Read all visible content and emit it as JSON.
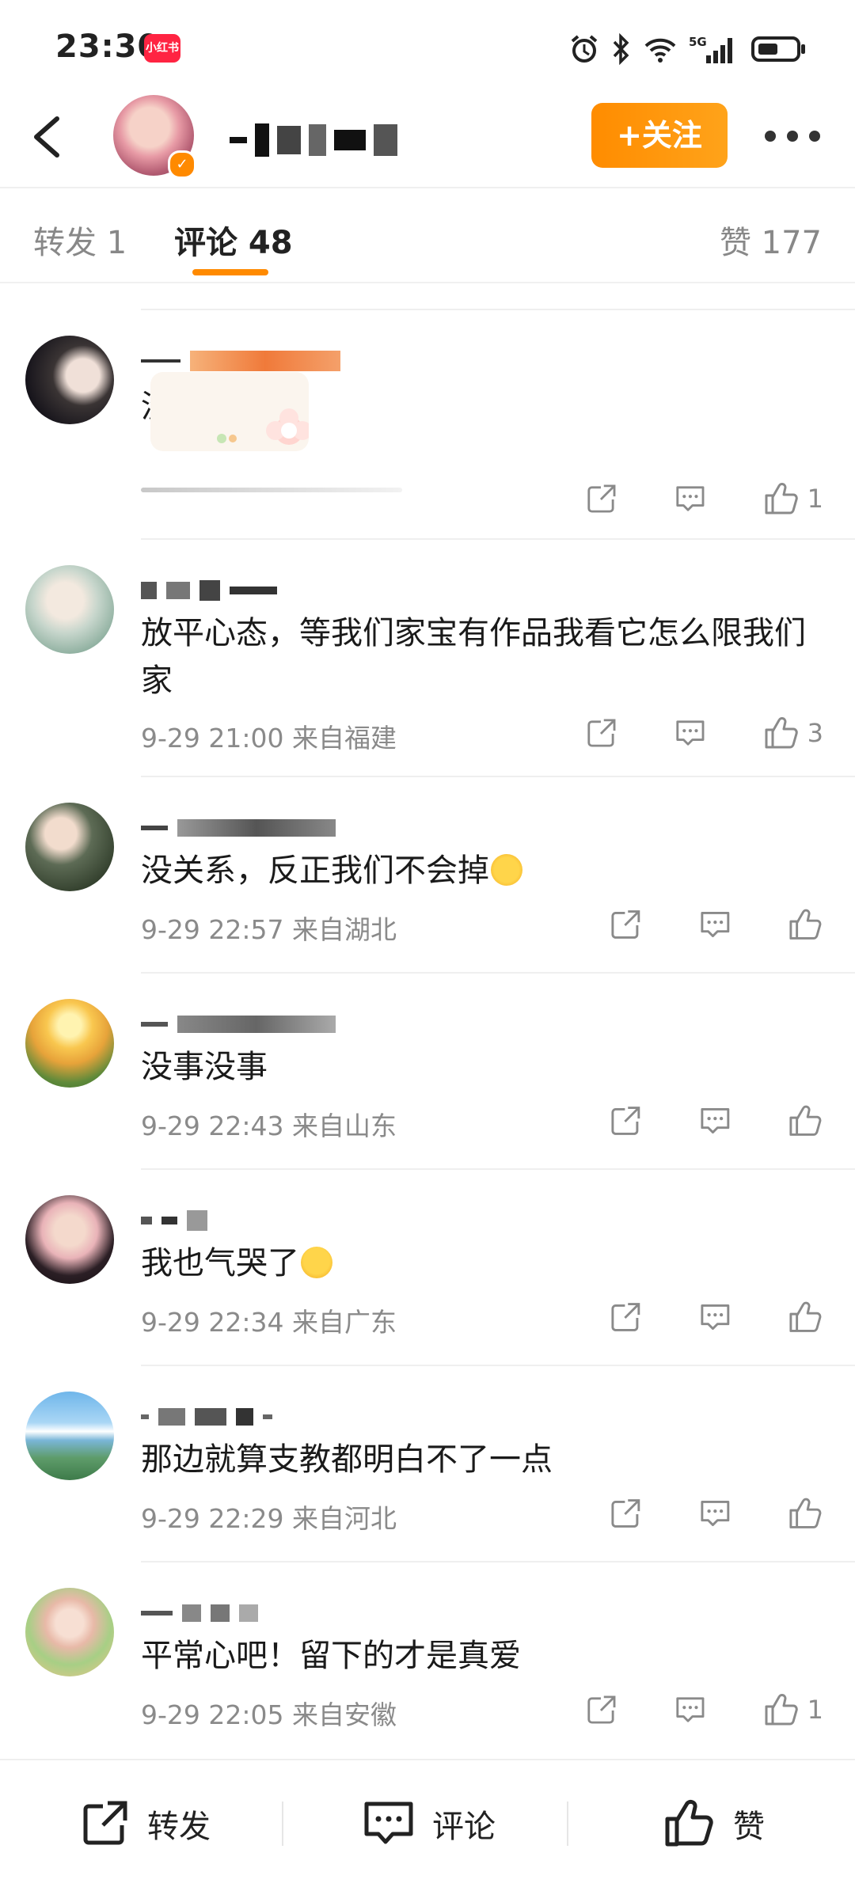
{
  "status": {
    "time": "23:30",
    "app_badge": "小红书",
    "network": "5G"
  },
  "header": {
    "follow_label": "+关注"
  },
  "tabs": {
    "repost": "转发 1",
    "comments": "评论 48",
    "likes": "赞 177"
  },
  "comments": [
    {
      "text": "没招了",
      "meta": "",
      "likes": "1"
    },
    {
      "text": "放平心态，等我们家宝有作品我看它怎么限我们家",
      "meta": "9-29 21:00 来自福建",
      "likes": "3"
    },
    {
      "text": "没关系，反正我们不会掉",
      "meta": "9-29 22:57 来自湖北",
      "likes": ""
    },
    {
      "text": "没事没事",
      "meta": "9-29 22:43 来自山东",
      "likes": ""
    },
    {
      "text": "我也气哭了",
      "meta": "9-29 22:34 来自广东",
      "likes": ""
    },
    {
      "text": "那边就算支教都明白不了一点",
      "meta": "9-29 22:29 来自河北",
      "likes": ""
    },
    {
      "text": "平常心吧！留下的才是真爱",
      "meta": "9-29 22:05 来自安徽",
      "likes": "1"
    }
  ],
  "bottom": {
    "repost": "转发",
    "comment": "评论",
    "like": "赞"
  },
  "colors": {
    "accent": "#ff8a00",
    "meta": "#8a8a8a"
  }
}
